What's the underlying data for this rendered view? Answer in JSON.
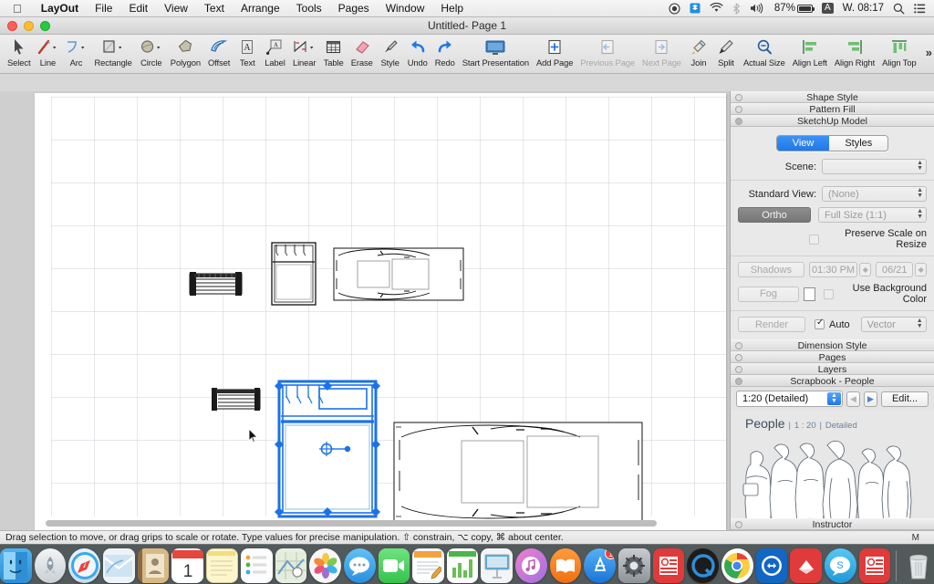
{
  "menubar": {
    "apple": "",
    "items": [
      {
        "label": "LayOut",
        "bold": true
      },
      {
        "label": "File"
      },
      {
        "label": "Edit"
      },
      {
        "label": "View"
      },
      {
        "label": "Text"
      },
      {
        "label": "Arrange"
      },
      {
        "label": "Tools"
      },
      {
        "label": "Pages"
      },
      {
        "label": "Window"
      },
      {
        "label": "Help"
      }
    ],
    "status": {
      "record_icon": "record-icon",
      "dropbox_icon": "dropbox-icon",
      "wifi_icon": "wifi-icon",
      "bluetooth_icon": "bluetooth-icon",
      "volume_icon": "volume-icon",
      "battery_percent": "87%",
      "input_source": "A",
      "time": "W. 08:17",
      "spotlight_icon": "search-icon",
      "notification_icon": "notification-center-icon"
    }
  },
  "window": {
    "title": "Untitled- Page 1"
  },
  "toolbar": {
    "items": [
      {
        "name": "select",
        "label": "Select",
        "caret": false,
        "disabled": false
      },
      {
        "name": "line",
        "label": "Line",
        "caret": true,
        "disabled": false
      },
      {
        "name": "arc",
        "label": "Arc",
        "caret": true,
        "disabled": false
      },
      {
        "name": "rectangle",
        "label": "Rectangle",
        "caret": true,
        "disabled": false
      },
      {
        "name": "circle",
        "label": "Circle",
        "caret": true,
        "disabled": false
      },
      {
        "name": "polygon",
        "label": "Polygon",
        "caret": false,
        "disabled": false
      },
      {
        "name": "offset",
        "label": "Offset",
        "caret": false,
        "disabled": false
      },
      {
        "name": "text",
        "label": "Text",
        "caret": false,
        "disabled": false
      },
      {
        "name": "label",
        "label": "Label",
        "caret": false,
        "disabled": false
      },
      {
        "name": "linear",
        "label": "Linear",
        "caret": true,
        "disabled": false
      },
      {
        "name": "table",
        "label": "Table",
        "caret": false,
        "disabled": false
      },
      {
        "name": "erase",
        "label": "Erase",
        "caret": false,
        "disabled": false
      },
      {
        "name": "style",
        "label": "Style",
        "caret": false,
        "disabled": false
      },
      {
        "name": "undo",
        "label": "Undo",
        "caret": false,
        "disabled": false
      },
      {
        "name": "redo",
        "label": "Redo",
        "caret": false,
        "disabled": false
      },
      {
        "name": "start-presentation",
        "label": "Start Presentation",
        "caret": false,
        "disabled": false
      },
      {
        "name": "add-page",
        "label": "Add Page",
        "caret": false,
        "disabled": false
      },
      {
        "name": "previous-page",
        "label": "Previous Page",
        "caret": false,
        "disabled": true
      },
      {
        "name": "next-page",
        "label": "Next Page",
        "caret": false,
        "disabled": true
      },
      {
        "name": "join",
        "label": "Join",
        "caret": false,
        "disabled": false
      },
      {
        "name": "split",
        "label": "Split",
        "caret": false,
        "disabled": false
      },
      {
        "name": "actual-size",
        "label": "Actual Size",
        "caret": false,
        "disabled": false
      },
      {
        "name": "align-left",
        "label": "Align Left",
        "caret": false,
        "disabled": false
      },
      {
        "name": "align-right",
        "label": "Align Right",
        "caret": false,
        "disabled": false
      },
      {
        "name": "align-top",
        "label": "Align Top",
        "caret": false,
        "disabled": false
      }
    ],
    "overflow": "»"
  },
  "inspector": {
    "sections": [
      {
        "title": "Shape Style",
        "open": false
      },
      {
        "title": "Pattern Fill",
        "open": false
      },
      {
        "title": "SketchUp Model",
        "open": true
      }
    ],
    "sketchup_model": {
      "tabs": [
        {
          "label": "View",
          "active": true
        },
        {
          "label": "Styles",
          "active": false
        }
      ],
      "scene_label": "Scene:",
      "scene_value": "",
      "standard_view_label": "Standard View:",
      "standard_view_value": "(None)",
      "ortho_label": "Ortho",
      "scale_value": "Full Size (1:1)",
      "preserve_scale_label": "Preserve Scale on Resize",
      "preserve_scale_checked": false,
      "shadows_label": "Shadows",
      "shadows_time": "01:30 PM",
      "shadows_date": "06/21",
      "fog_label": "Fog",
      "use_background_label": "Use Background Color",
      "use_background_checked": false,
      "render_label": "Render",
      "auto_label": "Auto",
      "auto_checked": true,
      "render_mode": "Vector"
    },
    "lower_sections": [
      {
        "title": "Dimension Style",
        "open": false
      },
      {
        "title": "Pages",
        "open": false
      },
      {
        "title": "Layers",
        "open": false
      },
      {
        "title": "Scrapbook - People",
        "open": true
      }
    ],
    "scrapbook": {
      "collection": "1:20 (Detailed)",
      "prev_icon": "arrow-left-icon",
      "next_icon": "arrow-right-icon",
      "edit_label": "Edit...",
      "title": "People",
      "scale_meta": "1 : 20",
      "detail_meta": "Detailed",
      "separator": "|"
    },
    "bottom_section": {
      "title": "Instructor",
      "open": false
    }
  },
  "statusbar": {
    "message": "Drag selection to move, or drag grips to scale or rotate. Type values for precise manipulation. ⇧ constrain, ⌥ copy, ⌘ about center.",
    "right_marker": "M"
  },
  "canvas": {
    "objects": [
      {
        "name": "bench-top",
        "type": "bench",
        "selected": false
      },
      {
        "name": "bed-small-top",
        "type": "bed",
        "selected": false
      },
      {
        "name": "car-top",
        "type": "car",
        "selected": false
      },
      {
        "name": "bench-bottom",
        "type": "bench",
        "selected": false
      },
      {
        "name": "bed-selected",
        "type": "bed",
        "selected": true
      },
      {
        "name": "car-bottom-large",
        "type": "car",
        "selected": false
      }
    ],
    "selection_color": "#1b72e8",
    "cursor": "arrow-cursor"
  },
  "dock": {
    "items": [
      {
        "name": "finder",
        "label": "Finder",
        "color": "#3aa2e8",
        "glyph": "☺",
        "running": true
      },
      {
        "name": "launchpad",
        "label": "Launchpad",
        "color": "#d5d8db",
        "glyph": "🚀",
        "running": false
      },
      {
        "name": "safari",
        "label": "Safari",
        "color": "#3aa8ef",
        "glyph": "🧭",
        "running": false
      },
      {
        "name": "mail",
        "label": "Mail",
        "color": "#e8edf2",
        "glyph": "✉",
        "running": false
      },
      {
        "name": "contacts",
        "label": "Contacts",
        "color": "#c49a5e",
        "glyph": "👤",
        "running": false
      },
      {
        "name": "calendar",
        "label": "Calendar",
        "color": "#ffffff",
        "glyph": "1",
        "running": false
      },
      {
        "name": "notes",
        "label": "Notes",
        "color": "#fdf3c2",
        "glyph": "",
        "running": false
      },
      {
        "name": "reminders",
        "label": "Reminders",
        "color": "#fbfbfb",
        "glyph": "•",
        "running": false
      },
      {
        "name": "maps",
        "label": "Maps",
        "color": "#d9e6c8",
        "glyph": "⌖",
        "running": false
      },
      {
        "name": "photos",
        "label": "Photos",
        "color": "#f5f5f5",
        "glyph": "❁",
        "running": false
      },
      {
        "name": "messages",
        "label": "Messages",
        "color": "#3aa8ef",
        "glyph": "💬",
        "running": false
      },
      {
        "name": "facetime",
        "label": "FaceTime",
        "color": "#4cd964",
        "glyph": "📹",
        "running": false
      },
      {
        "name": "pages",
        "label": "Pages",
        "color": "#f2a33c",
        "glyph": "✎",
        "running": false
      },
      {
        "name": "numbers",
        "label": "Numbers",
        "color": "#4cb648",
        "glyph": "▥",
        "running": false
      },
      {
        "name": "keynote",
        "label": "Keynote",
        "color": "#3ba7dd",
        "glyph": "▤",
        "running": false
      },
      {
        "name": "itunes",
        "label": "iTunes",
        "color": "#e86ab5",
        "glyph": "♪",
        "running": false
      },
      {
        "name": "ibooks",
        "label": "iBooks",
        "color": "#f08020",
        "glyph": "📖",
        "running": false
      },
      {
        "name": "app-store",
        "label": "App Store",
        "color": "#2f8fe8",
        "glyph": "A",
        "badge": "1",
        "running": false
      },
      {
        "name": "system-preferences",
        "label": "System Preferences",
        "color": "#9a9a9a",
        "glyph": "⚙",
        "running": false
      },
      {
        "name": "layout",
        "label": "LayOut",
        "color": "#e03a3a",
        "glyph": "▤",
        "running": true
      },
      {
        "name": "quicktime",
        "label": "QuickTime Player",
        "color": "#1b1b1b",
        "glyph": "Q",
        "running": true
      },
      {
        "name": "chrome",
        "label": "Google Chrome",
        "color": "#ffffff",
        "glyph": "◉",
        "running": true
      },
      {
        "name": "teamviewer",
        "label": "TeamViewer",
        "color": "#1266c4",
        "glyph": "↔",
        "running": true
      },
      {
        "name": "sketchup",
        "label": "SketchUp",
        "color": "#e03a3a",
        "glyph": "✐",
        "running": true
      },
      {
        "name": "skype",
        "label": "Skype",
        "color": "#39aee8",
        "glyph": "S",
        "running": true
      },
      {
        "name": "layout-doc",
        "label": "LayOut Document",
        "color": "#e03a3a",
        "glyph": "▤",
        "running": true
      },
      {
        "name": "trash",
        "label": "Trash",
        "color": "#e8e8e8",
        "glyph": "🗑",
        "running": false
      }
    ]
  }
}
